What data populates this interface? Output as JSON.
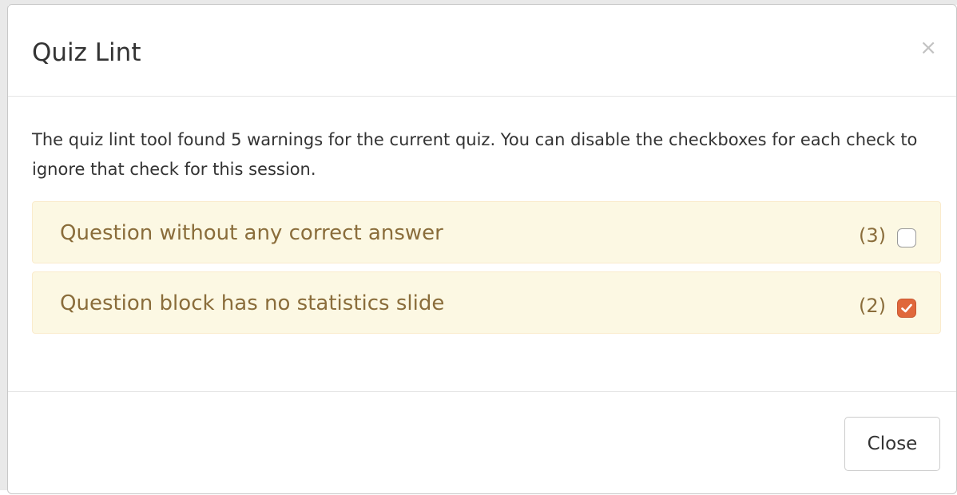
{
  "dialog": {
    "title": "Quiz Lint",
    "close_glyph": "×",
    "intro": "The quiz lint tool found 5 warnings for the current quiz. You can disable the checkboxes for each check to ignore that check for this session.",
    "warnings": [
      {
        "label": "Question without any correct answer",
        "count": "(3)",
        "checked": false
      },
      {
        "label": "Question block has no statistics slide",
        "count": "(2)",
        "checked": true
      }
    ],
    "footer": {
      "close_label": "Close"
    }
  },
  "colors": {
    "warning_bg": "#fcf8e3",
    "warning_border": "#faebcc",
    "warning_text": "#8a6d3b",
    "checkbox_checked": "#e0683c",
    "text": "#333333"
  },
  "icons": {
    "dismiss": "close-icon",
    "check": "checkmark-icon"
  }
}
